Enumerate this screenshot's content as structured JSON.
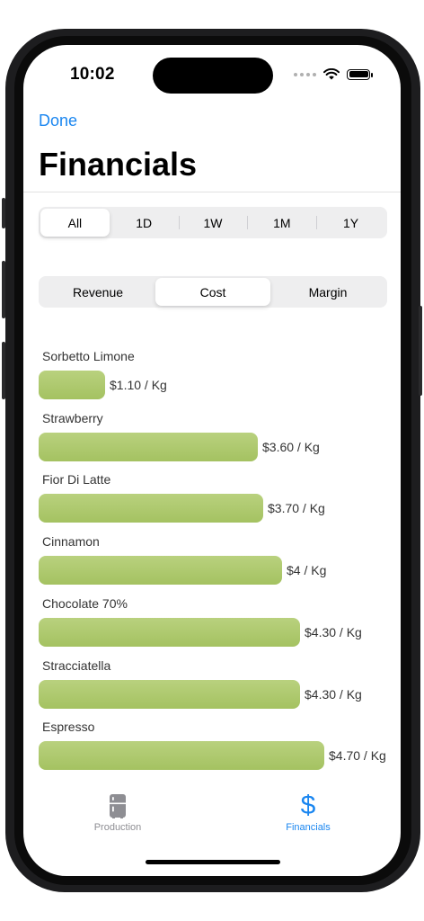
{
  "status_bar": {
    "time": "10:02"
  },
  "nav": {
    "done_label": "Done",
    "title": "Financials"
  },
  "range_segments": {
    "items": [
      "All",
      "1D",
      "1W",
      "1M",
      "1Y"
    ],
    "selected": "All"
  },
  "metric_segments": {
    "items": [
      "Revenue",
      "Cost",
      "Margin"
    ],
    "selected": "Cost"
  },
  "chart_data": {
    "type": "bar",
    "orientation": "horizontal",
    "categories": [
      "Sorbetto Limone",
      "Strawberry",
      "Fior Di Latte",
      "Cinnamon",
      "Chocolate 70%",
      "Stracciatella",
      "Espresso"
    ],
    "values": [
      1.1,
      3.6,
      3.7,
      4.0,
      4.3,
      4.3,
      4.7
    ],
    "value_labels": [
      "$1.10 / Kg",
      "$3.60 / Kg",
      "$3.70 / Kg",
      "$4 / Kg",
      "$4.30 / Kg",
      "$4.30 / Kg",
      "$4.70 / Kg"
    ],
    "bar_color": "#aac66b"
  },
  "tab_bar": {
    "items": [
      {
        "label": "Production",
        "icon": "refrigerator-icon",
        "selected": false
      },
      {
        "label": "Financials",
        "icon": "dollar-sign-icon",
        "selected": true
      }
    ],
    "accent_color": "#1a86f0",
    "inactive_color": "#8e8e93"
  }
}
